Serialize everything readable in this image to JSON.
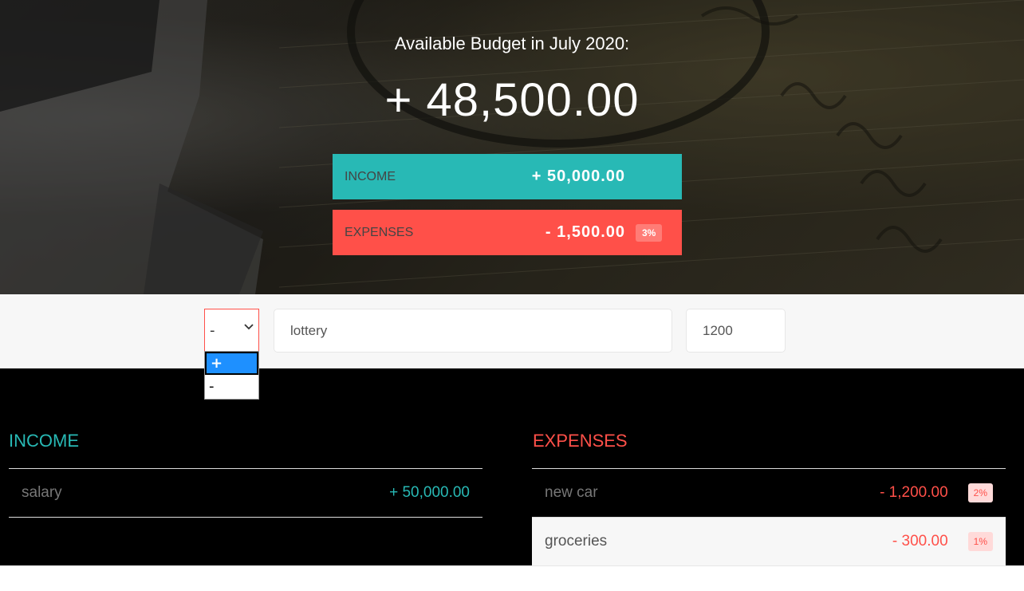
{
  "budget": {
    "title": "Available Budget in July 2020:",
    "value": "+ 48,500.00",
    "income": {
      "label": "INCOME",
      "value": "+ 50,000.00"
    },
    "expenses": {
      "label": "EXPENSES",
      "value": "- 1,500.00",
      "percentage": "3%"
    }
  },
  "add_form": {
    "type_selected": "-",
    "type_options": [
      "+",
      "-"
    ],
    "highlighted_option": "+",
    "description": "lottery",
    "value": "1200"
  },
  "income_list": {
    "title": "INCOME",
    "items": [
      {
        "description": "salary",
        "value": "+ 50,000.00"
      }
    ]
  },
  "expenses_list": {
    "title": "EXPENSES",
    "items": [
      {
        "description": "new car",
        "value": "- 1,200.00",
        "percentage": "2%"
      },
      {
        "description": "groceries",
        "value": "- 300.00",
        "percentage": "1%"
      }
    ]
  },
  "colors": {
    "income": "#28b9b5",
    "expenses": "#ff5049",
    "dropdown_highlight": "#1e90ff"
  },
  "icons": [
    "chevron-down-icon"
  ]
}
